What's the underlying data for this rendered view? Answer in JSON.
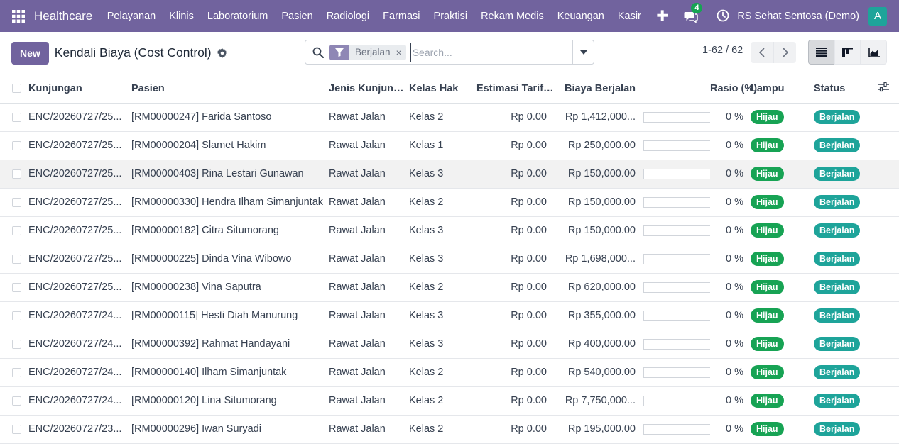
{
  "navbar": {
    "app_name": "Healthcare",
    "menu": [
      "Pelayanan",
      "Klinis",
      "Laboratorium",
      "Pasien",
      "Radiologi",
      "Farmasi",
      "Praktisi",
      "Rekam Medis",
      "Keuangan",
      "Kasir"
    ],
    "plus": "✚",
    "chat_count": "4",
    "company": "RS Sehat Sentosa (Demo)",
    "avatar_letter": "A",
    "brand_color": "#71639e"
  },
  "control": {
    "new_label": "New",
    "title": "Kendali Biaya (Cost Control)",
    "facet_label": "Berjalan",
    "facet_remove": "×",
    "search_placeholder": "Search...",
    "pager": "1-62 / 62"
  },
  "table": {
    "headers": {
      "kunjungan": "Kunjungan",
      "pasien": "Pasien",
      "jenis": "Jenis Kunjungan",
      "kelas": "Kelas Hak",
      "estimasi": "Estimasi Tarif INA-CBG",
      "biaya": "Biaya Berjalan",
      "rasio": "Rasio (%)",
      "lampu": "Lampu",
      "status": "Status"
    },
    "rows": [
      {
        "kunjungan": "ENC/20260727/25...",
        "pasien": "[RM00000247] Farida Santoso",
        "jenis": "Rawat Jalan",
        "kelas": "Kelas 2",
        "estimasi": "Rp 0.00",
        "biaya": "Rp 1,412,000...",
        "progress": 0,
        "rasio": "0 %",
        "lampu": "Hijau",
        "status": "Berjalan"
      },
      {
        "kunjungan": "ENC/20260727/25...",
        "pasien": "[RM00000204] Slamet Hakim",
        "jenis": "Rawat Jalan",
        "kelas": "Kelas 1",
        "estimasi": "Rp 0.00",
        "biaya": "Rp 250,000.00",
        "progress": 0,
        "rasio": "0 %",
        "lampu": "Hijau",
        "status": "Berjalan"
      },
      {
        "kunjungan": "ENC/20260727/25...",
        "pasien": "[RM00000403] Rina Lestari Gunawan",
        "jenis": "Rawat Jalan",
        "kelas": "Kelas 3",
        "estimasi": "Rp 0.00",
        "biaya": "Rp 150,000.00",
        "progress": 0,
        "rasio": "0 %",
        "lampu": "Hijau",
        "status": "Berjalan"
      },
      {
        "kunjungan": "ENC/20260727/25...",
        "pasien": "[RM00000330] Hendra Ilham Simanjuntak",
        "jenis": "Rawat Jalan",
        "kelas": "Kelas 2",
        "estimasi": "Rp 0.00",
        "biaya": "Rp 150,000.00",
        "progress": 0,
        "rasio": "0 %",
        "lampu": "Hijau",
        "status": "Berjalan"
      },
      {
        "kunjungan": "ENC/20260727/25...",
        "pasien": "[RM00000182] Citra Situmorang",
        "jenis": "Rawat Jalan",
        "kelas": "Kelas 3",
        "estimasi": "Rp 0.00",
        "biaya": "Rp 150,000.00",
        "progress": 0,
        "rasio": "0 %",
        "lampu": "Hijau",
        "status": "Berjalan"
      },
      {
        "kunjungan": "ENC/20260727/25...",
        "pasien": "[RM00000225] Dinda Vina Wibowo",
        "jenis": "Rawat Jalan",
        "kelas": "Kelas 3",
        "estimasi": "Rp 0.00",
        "biaya": "Rp 1,698,000...",
        "progress": 0,
        "rasio": "0 %",
        "lampu": "Hijau",
        "status": "Berjalan"
      },
      {
        "kunjungan": "ENC/20260727/25...",
        "pasien": "[RM00000238] Vina Saputra",
        "jenis": "Rawat Jalan",
        "kelas": "Kelas 2",
        "estimasi": "Rp 0.00",
        "biaya": "Rp 620,000.00",
        "progress": 0,
        "rasio": "0 %",
        "lampu": "Hijau",
        "status": "Berjalan"
      },
      {
        "kunjungan": "ENC/20260727/24...",
        "pasien": "[RM00000115] Hesti Diah Manurung",
        "jenis": "Rawat Jalan",
        "kelas": "Kelas 3",
        "estimasi": "Rp 0.00",
        "biaya": "Rp 355,000.00",
        "progress": 0,
        "rasio": "0 %",
        "lampu": "Hijau",
        "status": "Berjalan"
      },
      {
        "kunjungan": "ENC/20260727/24...",
        "pasien": "[RM00000392] Rahmat Handayani",
        "jenis": "Rawat Jalan",
        "kelas": "Kelas 3",
        "estimasi": "Rp 0.00",
        "biaya": "Rp 400,000.00",
        "progress": 0,
        "rasio": "0 %",
        "lampu": "Hijau",
        "status": "Berjalan"
      },
      {
        "kunjungan": "ENC/20260727/24...",
        "pasien": "[RM00000140] Ilham Simanjuntak",
        "jenis": "Rawat Jalan",
        "kelas": "Kelas 2",
        "estimasi": "Rp 0.00",
        "biaya": "Rp 540,000.00",
        "progress": 0,
        "rasio": "0 %",
        "lampu": "Hijau",
        "status": "Berjalan"
      },
      {
        "kunjungan": "ENC/20260727/24...",
        "pasien": "[RM00000120] Lina Situmorang",
        "jenis": "Rawat Jalan",
        "kelas": "Kelas 2",
        "estimasi": "Rp 0.00",
        "biaya": "Rp 7,750,000...",
        "progress": 0,
        "rasio": "0 %",
        "lampu": "Hijau",
        "status": "Berjalan"
      },
      {
        "kunjungan": "ENC/20260727/23...",
        "pasien": "[RM00000296] Iwan Suryadi",
        "jenis": "Rawat Jalan",
        "kelas": "Kelas 2",
        "estimasi": "Rp 0.00",
        "biaya": "Rp 195,000.00",
        "progress": 0,
        "rasio": "0 %",
        "lampu": "Hijau",
        "status": "Berjalan"
      }
    ]
  }
}
